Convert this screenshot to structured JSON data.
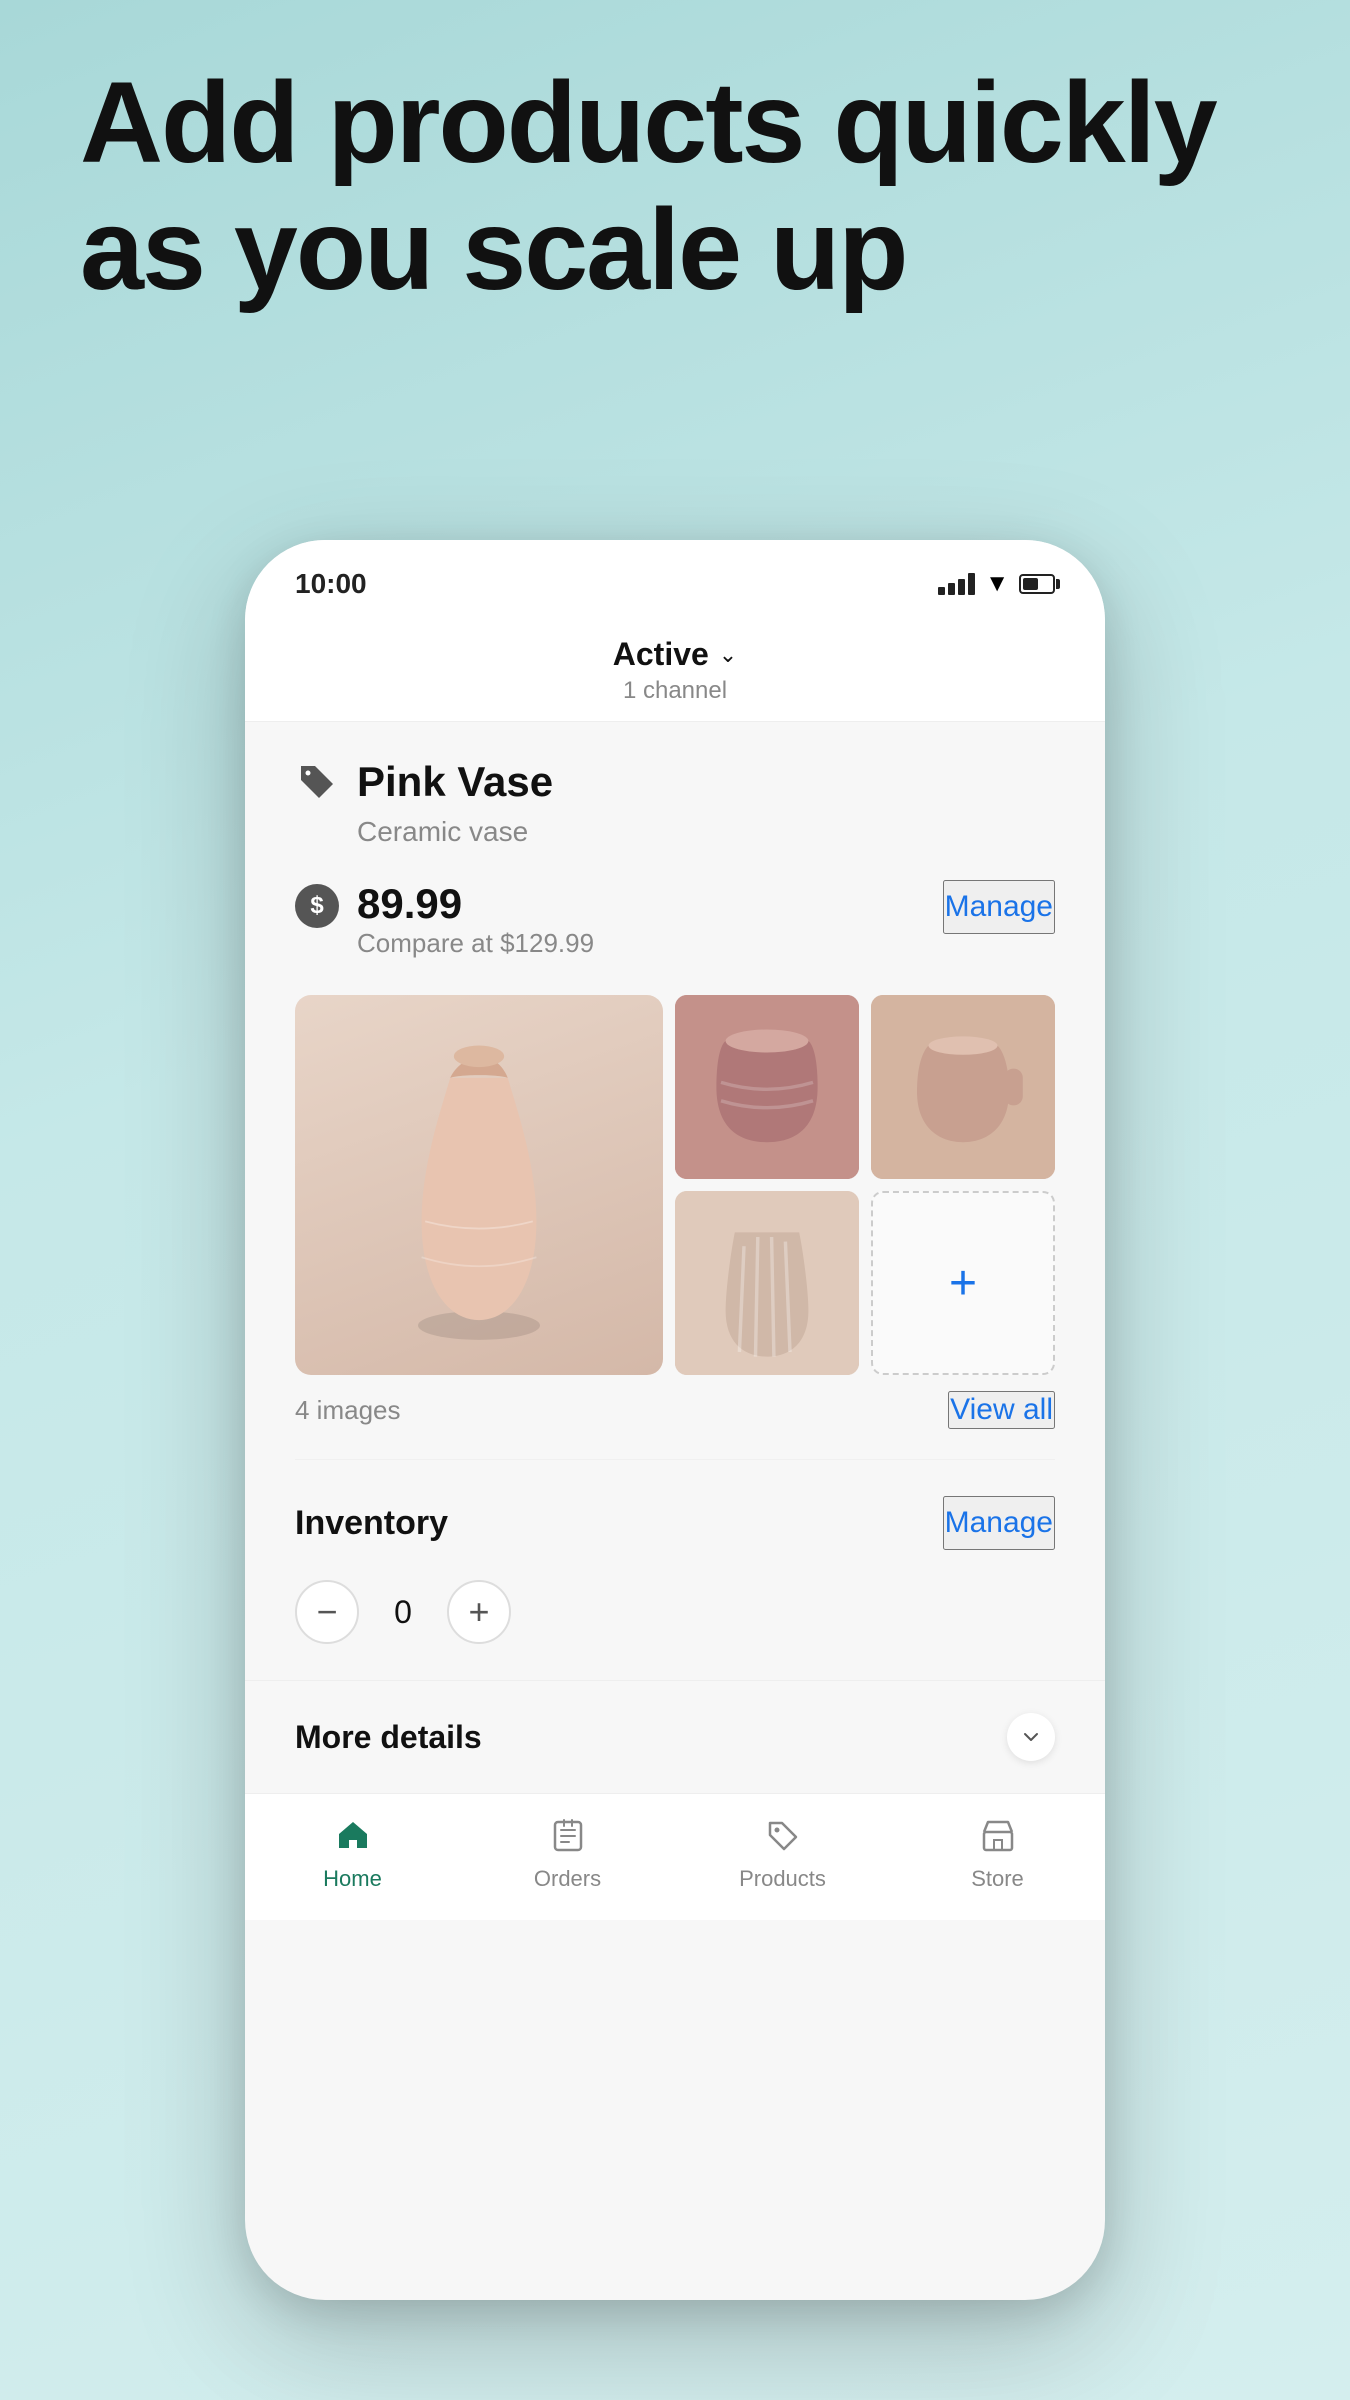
{
  "hero": {
    "title": "Add products quickly as you scale up"
  },
  "status_bar": {
    "time": "10:00"
  },
  "product_header": {
    "status_label": "Active",
    "channel_text": "1 channel"
  },
  "product": {
    "name": "Pink Vase",
    "description": "Ceramic vase",
    "price": "89.99",
    "compare_price": "Compare at $129.99",
    "images_count": "4 images",
    "view_all": "View all",
    "manage_price_label": "Manage"
  },
  "inventory": {
    "title": "Inventory",
    "manage_label": "Manage",
    "quantity": "0",
    "decrement": "−",
    "increment": "+"
  },
  "more_details": {
    "label": "More details"
  },
  "bottom_nav": {
    "home": "Home",
    "orders": "Orders",
    "products": "Products",
    "store": "Store"
  }
}
